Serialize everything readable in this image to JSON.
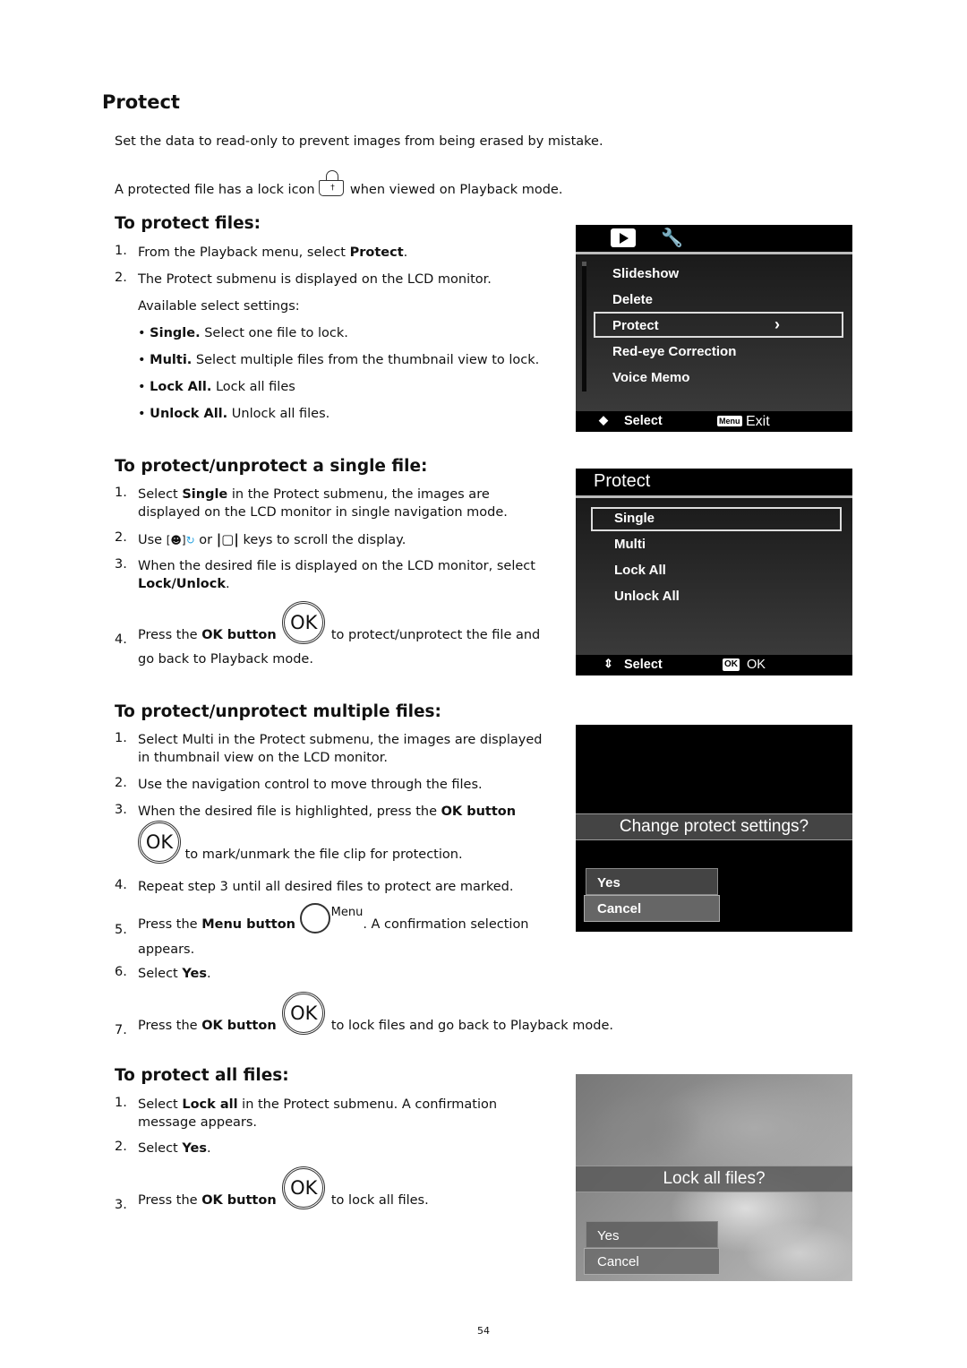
{
  "page": {
    "title": "Protect",
    "intro": "Set the data to read-only to prevent images from being erased by mistake.",
    "lock_line_before": "A protected file has a lock icon",
    "lock_line_after": "when viewed on Playback mode.",
    "page_number": "54"
  },
  "icons": {
    "ok_label": "OK",
    "menu_label": "Menu",
    "keyhole": "†"
  },
  "section1": {
    "heading": "To protect files:",
    "steps": [
      {
        "n": "1.",
        "pre": "From the Playback menu, select ",
        "bold": "Protect",
        "post": "."
      },
      {
        "n": "2.",
        "text": "The Protect submenu is displayed on the LCD monitor.",
        "sub": "Available select settings:"
      }
    ],
    "bullets": [
      {
        "bold": "Single.",
        "text": " Select one file to lock."
      },
      {
        "bold": "Multi.",
        "text": " Select multiple files from the thumbnail view to lock."
      },
      {
        "bold": "Lock All.",
        "text": " Lock all files"
      },
      {
        "bold": "Unlock All.",
        "text": " Unlock all files."
      }
    ]
  },
  "section2": {
    "heading": "To protect/unprotect a single file:",
    "s1_n": "1.",
    "s1_pre": "Select ",
    "s1_bold": "Single",
    "s1_post": " in the Protect submenu, the images are",
    "s1_line2": "displayed on the LCD monitor in single navigation mode.",
    "s2_n": "2.",
    "s2_pre": "Use",
    "s2_mid": "or",
    "s2_post": "keys to scroll the display.",
    "s3_n": "3.",
    "s3_text": "When the desired file is displayed on the LCD monitor, select",
    "s3_bold": "Lock/Unlock",
    "s3_post": ".",
    "s4_n": "4.",
    "s4_pre": "Press the ",
    "s4_bold": "OK button",
    "s4_post": "to protect/unprotect the file and",
    "s4_line2": "go back to Playback mode."
  },
  "section3": {
    "heading": "To protect/unprotect multiple files:",
    "s1_n": "1.",
    "s1_text": "Select Multi in the Protect submenu, the images are displayed",
    "s1_line2": "in thumbnail view on the LCD monitor.",
    "s2_n": "2.",
    "s2_text": "Use the navigation control to move through the files.",
    "s3_n": "3.",
    "s3_pre": "When the desired file is highlighted, press the ",
    "s3_bold": "OK button",
    "s3_line2": "to mark/unmark the file clip for protection.",
    "s4_n": "4.",
    "s4_text": "Repeat step 3 until all desired files to protect are marked.",
    "s5_n": "5.",
    "s5_pre": "Press the ",
    "s5_bold": "Menu button",
    "s5_post": ". A confirmation selection",
    "s5_line2": "appears.",
    "s6_n": "6.",
    "s6_pre": "Select ",
    "s6_bold": "Yes",
    "s6_post": ".",
    "s7_n": "7.",
    "s7_pre": "Press the ",
    "s7_bold": "OK button",
    "s7_post": "to lock files and go back to Playback mode."
  },
  "section4": {
    "heading": "To protect all files:",
    "s1_n": "1.",
    "s1_pre": "Select ",
    "s1_bold": "Lock all",
    "s1_post": " in the Protect submenu. A confirmation",
    "s1_line2": "message appears.",
    "s2_n": "2.",
    "s2_pre": "Select ",
    "s2_bold": "Yes",
    "s2_post": ".",
    "s3_n": "3.",
    "s3_pre": "Press the ",
    "s3_bold": "OK button",
    "s3_post": "to lock all files."
  },
  "screen1": {
    "items": [
      "Slideshow",
      "Delete",
      "Protect",
      "Red-eye Correction",
      "Voice Memo"
    ],
    "selected_index": 2,
    "chevron": "›",
    "footer_select": "Select",
    "footer_menu_badge": "Menu",
    "footer_exit": "Exit"
  },
  "screen2": {
    "title": "Protect",
    "items": [
      "Single",
      "Multi",
      "Lock All",
      "Unlock All"
    ],
    "selected_index": 0,
    "footer_select": "Select",
    "footer_ok_badge": "OK",
    "footer_ok": "OK"
  },
  "screen3": {
    "prompt": "Change protect settings?",
    "yes": "Yes",
    "cancel": "Cancel",
    "highlighted": "Cancel"
  },
  "screen4": {
    "prompt": "Lock all files?",
    "yes": "Yes",
    "cancel": "Cancel",
    "highlighted": "Cancel"
  }
}
